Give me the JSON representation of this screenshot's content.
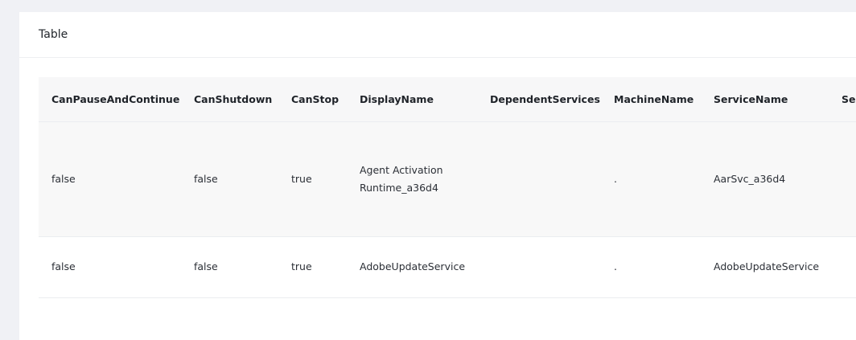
{
  "card": {
    "title": "Table"
  },
  "table": {
    "columns": [
      "CanPauseAndContinue",
      "CanShutdown",
      "CanStop",
      "DisplayName",
      "DependentServices",
      "MachineName",
      "ServiceName",
      "Se"
    ],
    "rows": [
      {
        "CanPauseAndContinue": "false",
        "CanShutdown": "false",
        "CanStop": "true",
        "DisplayName": "Agent Activation Runtime_a36d4",
        "DependentServices": "",
        "MachineName": ".",
        "ServiceName": "AarSvc_a36d4",
        "Se": ""
      },
      {
        "CanPauseAndContinue": "false",
        "CanShutdown": "false",
        "CanStop": "true",
        "DisplayName": "AdobeUpdateService",
        "DependentServices": "",
        "MachineName": ".",
        "ServiceName": "AdobeUpdateService",
        "Se": ""
      }
    ]
  }
}
